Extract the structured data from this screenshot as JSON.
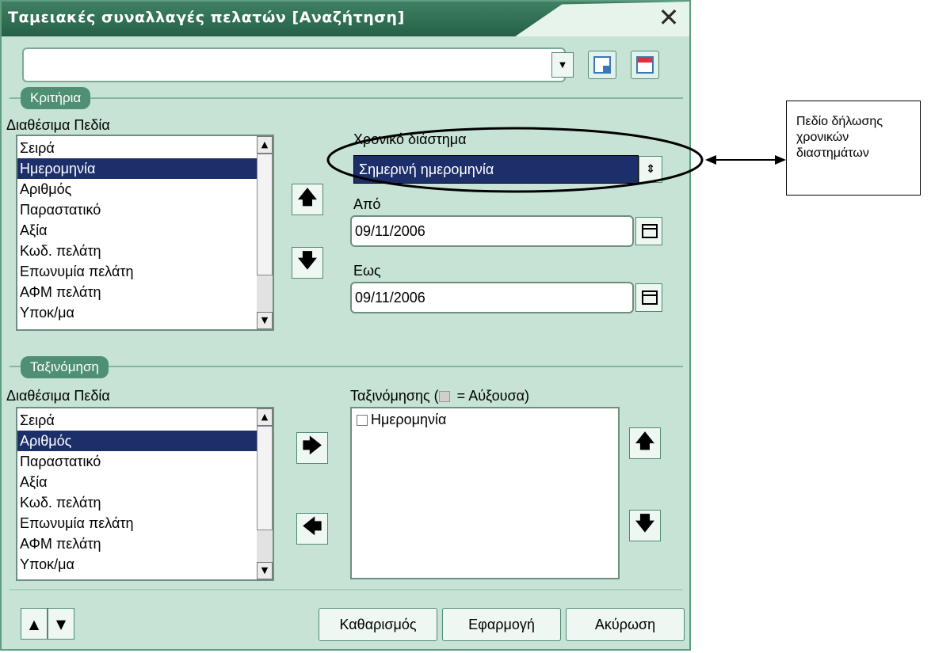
{
  "window": {
    "title": "Ταμειακές συναλλαγές πελατών [Αναζήτηση]",
    "close_icon": "close-icon",
    "accent": "#2f6e52",
    "background": "#c6e3d6"
  },
  "toolbar": {
    "combo_value": "",
    "dropdown_icon": "chevron-down-icon",
    "button1_icon": "select-all-icon",
    "button2_icon": "clear-selection-icon"
  },
  "criteria": {
    "group_label": "Κριτήρια",
    "available_label": "Διαθέσιμα Πεδία",
    "fields": [
      "Σειρά",
      "Ημερομηνία",
      "Αριθμός",
      "Παραστατικό",
      "Αξία",
      "Κωδ. πελάτη",
      "Επωνυμία πελάτη",
      "ΑΦΜ πελάτη",
      "Υποκ/μα"
    ],
    "selected": "Ημερομηνία",
    "period_label": "Χρονικό διάστημα",
    "period_value": "Σημερινή ημερομηνία",
    "from_label": "Από",
    "from_value": "09/11/2006",
    "to_label": "Εως",
    "to_value": "09/11/2006"
  },
  "sorting": {
    "group_label": "Ταξινόμηση",
    "available_label": "Διαθέσιμα Πεδία",
    "fields": [
      "Σειρά",
      "Αριθμός",
      "Παραστατικό",
      "Αξία",
      "Κωδ. πελάτη",
      "Επωνυμία πελάτη",
      "ΑΦΜ πελάτη",
      "Υποκ/μα"
    ],
    "selected": "Αριθμός",
    "sort_label_prefix": "Ταξινόμησης (",
    "sort_label_suffix": " = Αύξουσα)",
    "sort_items": [
      "Ημερομηνία"
    ]
  },
  "buttons": {
    "clear": "Καθαρισμός",
    "apply": "Εφαρμογή",
    "cancel": "Ακύρωση"
  },
  "annotation": {
    "lines": [
      "Πεδίο δήλωσης",
      "χρονικών",
      "διαστημάτων"
    ]
  }
}
